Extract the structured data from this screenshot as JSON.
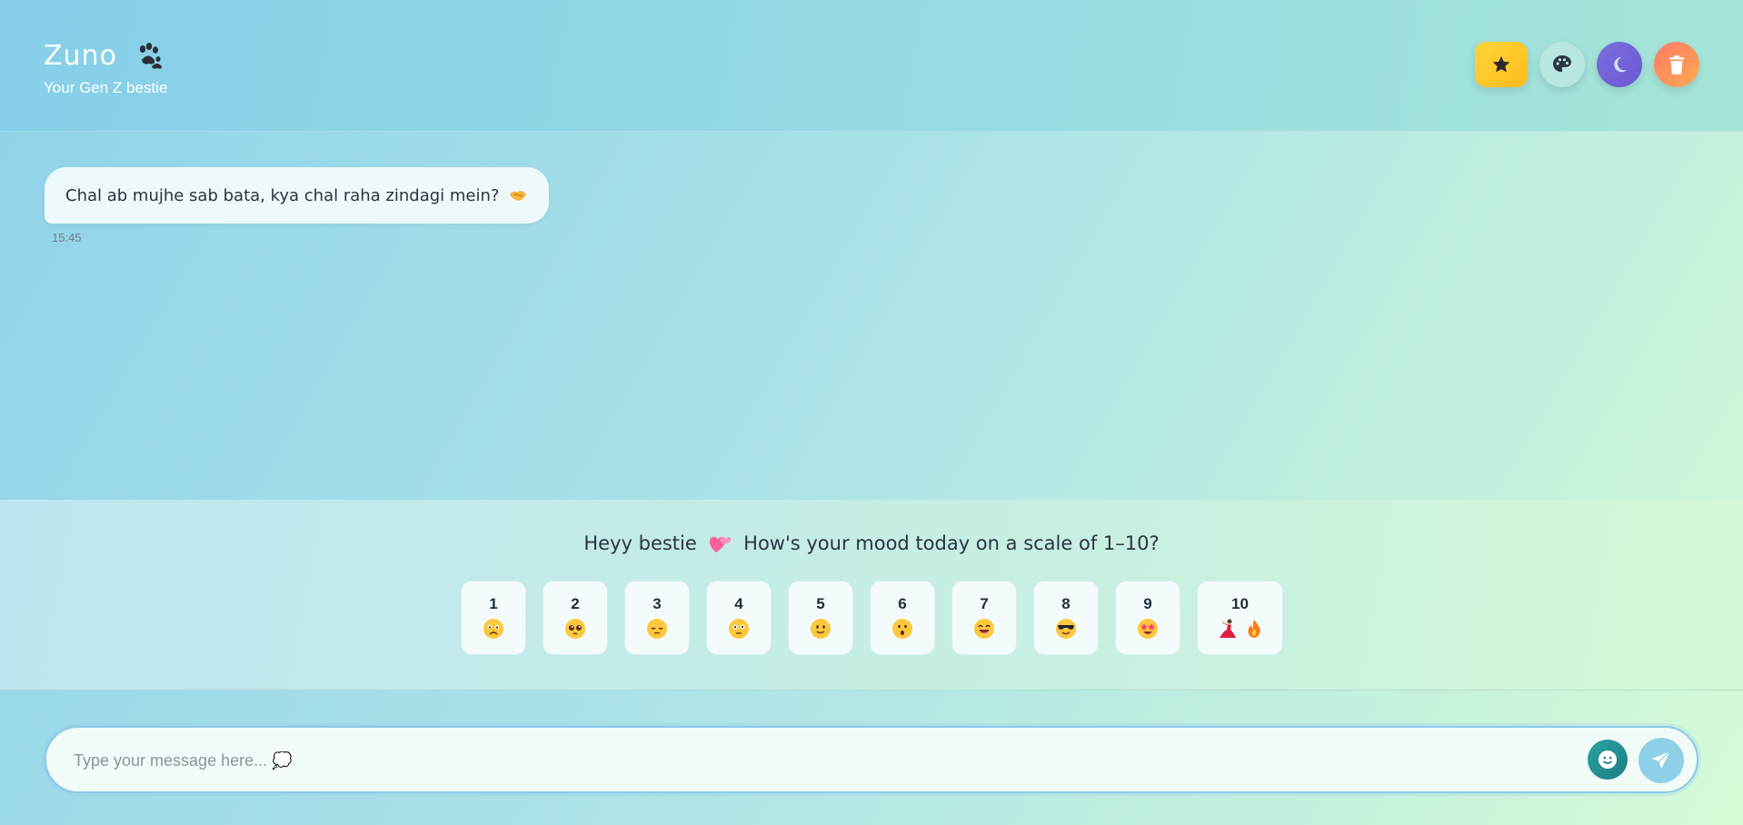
{
  "header": {
    "app_name": "Zuno",
    "tagline": "Your Gen Z bestie",
    "buttons": {
      "favorites_icon": "star-icon",
      "theme_icon": "palette-icon",
      "dark_mode_icon": "moon-icon",
      "clear_icon": "trash-icon"
    }
  },
  "chat": {
    "messages": [
      {
        "text": "Chal ab mujhe sab bata, kya chal raha zindagi mein?",
        "emoji": "handshake-emoji",
        "time": "15:45"
      }
    ]
  },
  "mood": {
    "question_part1": "Heyy bestie",
    "question_part2": "How's your mood today on a scale of 1–10?",
    "options": [
      {
        "label": "1",
        "emoji": "sad-face"
      },
      {
        "label": "2",
        "emoji": "pleading-face"
      },
      {
        "label": "3",
        "emoji": "pensive-face"
      },
      {
        "label": "4",
        "emoji": "neutral-face"
      },
      {
        "label": "5",
        "emoji": "slight-smile-face"
      },
      {
        "label": "6",
        "emoji": "hushed-face"
      },
      {
        "label": "7",
        "emoji": "grin-face"
      },
      {
        "label": "8",
        "emoji": "sunglasses-face"
      },
      {
        "label": "9",
        "emoji": "star-struck-face"
      },
      {
        "label": "10",
        "emoji": "dancer-fire"
      }
    ]
  },
  "composer": {
    "placeholder": "Type your message here... 💭",
    "value": ""
  },
  "colors": {
    "accent_star": "#ffc629",
    "accent_moon": "#7262d8",
    "accent_trash": "#ff8a5c",
    "send": "#8fd0e8"
  }
}
